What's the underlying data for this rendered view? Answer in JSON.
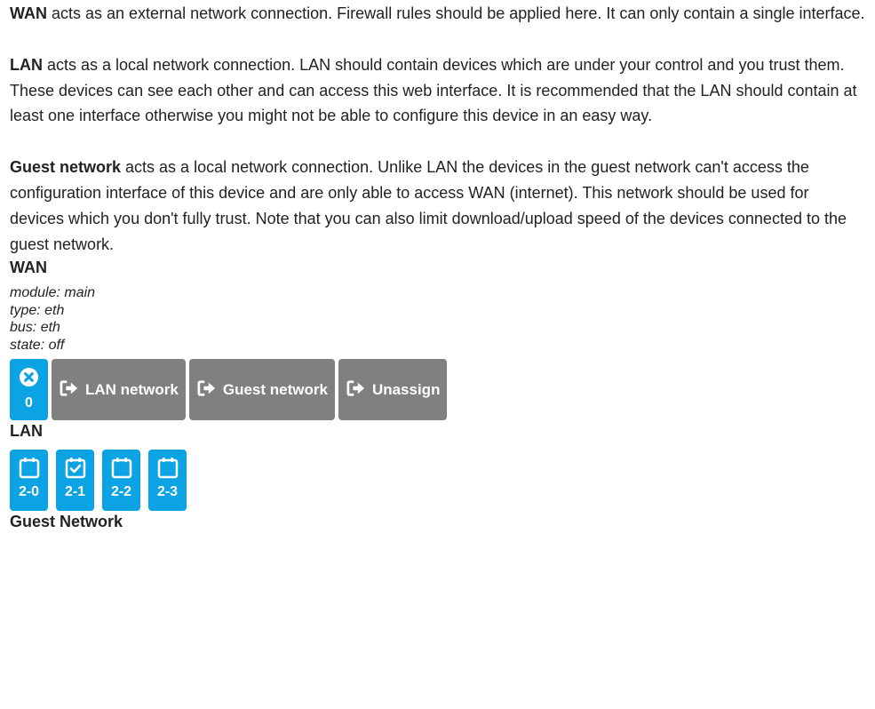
{
  "descriptions": {
    "wan": {
      "term": "WAN",
      "text": " acts as an external network connection. Firewall rules should be applied here. It can only contain a single interface."
    },
    "lan": {
      "term": "LAN",
      "text": " acts as a local network connection. LAN should contain devices which are under your control and you trust them. These devices can see each other and can access this web interface. It is recommended that the LAN should contain at least one interface otherwise you might not be able to configure this device in an easy way."
    },
    "guest": {
      "term": "Guest network",
      "text": " acts as a local network connection. Unlike LAN the devices in the guest network can't access the configuration interface of this device and are only able to access WAN (internet). This network should be used for devices which you don't fully trust. Note that you can also limit download/upload speed of the devices connected to the guest network."
    }
  },
  "wan": {
    "heading": "WAN",
    "info": [
      "module: main",
      "type: eth",
      "bus: eth",
      "state: off"
    ],
    "interface_label": "0",
    "actions": {
      "lan": "LAN network",
      "guest": "Guest network",
      "unassign": "Unassign"
    }
  },
  "lan": {
    "heading": "LAN",
    "interfaces": [
      {
        "label": "2-0",
        "selected": false
      },
      {
        "label": "2-1",
        "selected": true
      },
      {
        "label": "2-2",
        "selected": false
      },
      {
        "label": "2-3",
        "selected": false
      }
    ]
  },
  "guest": {
    "heading": "Guest Network"
  },
  "colors": {
    "accent": "#0ba3e3",
    "action": "#808080",
    "text": "#222222"
  }
}
